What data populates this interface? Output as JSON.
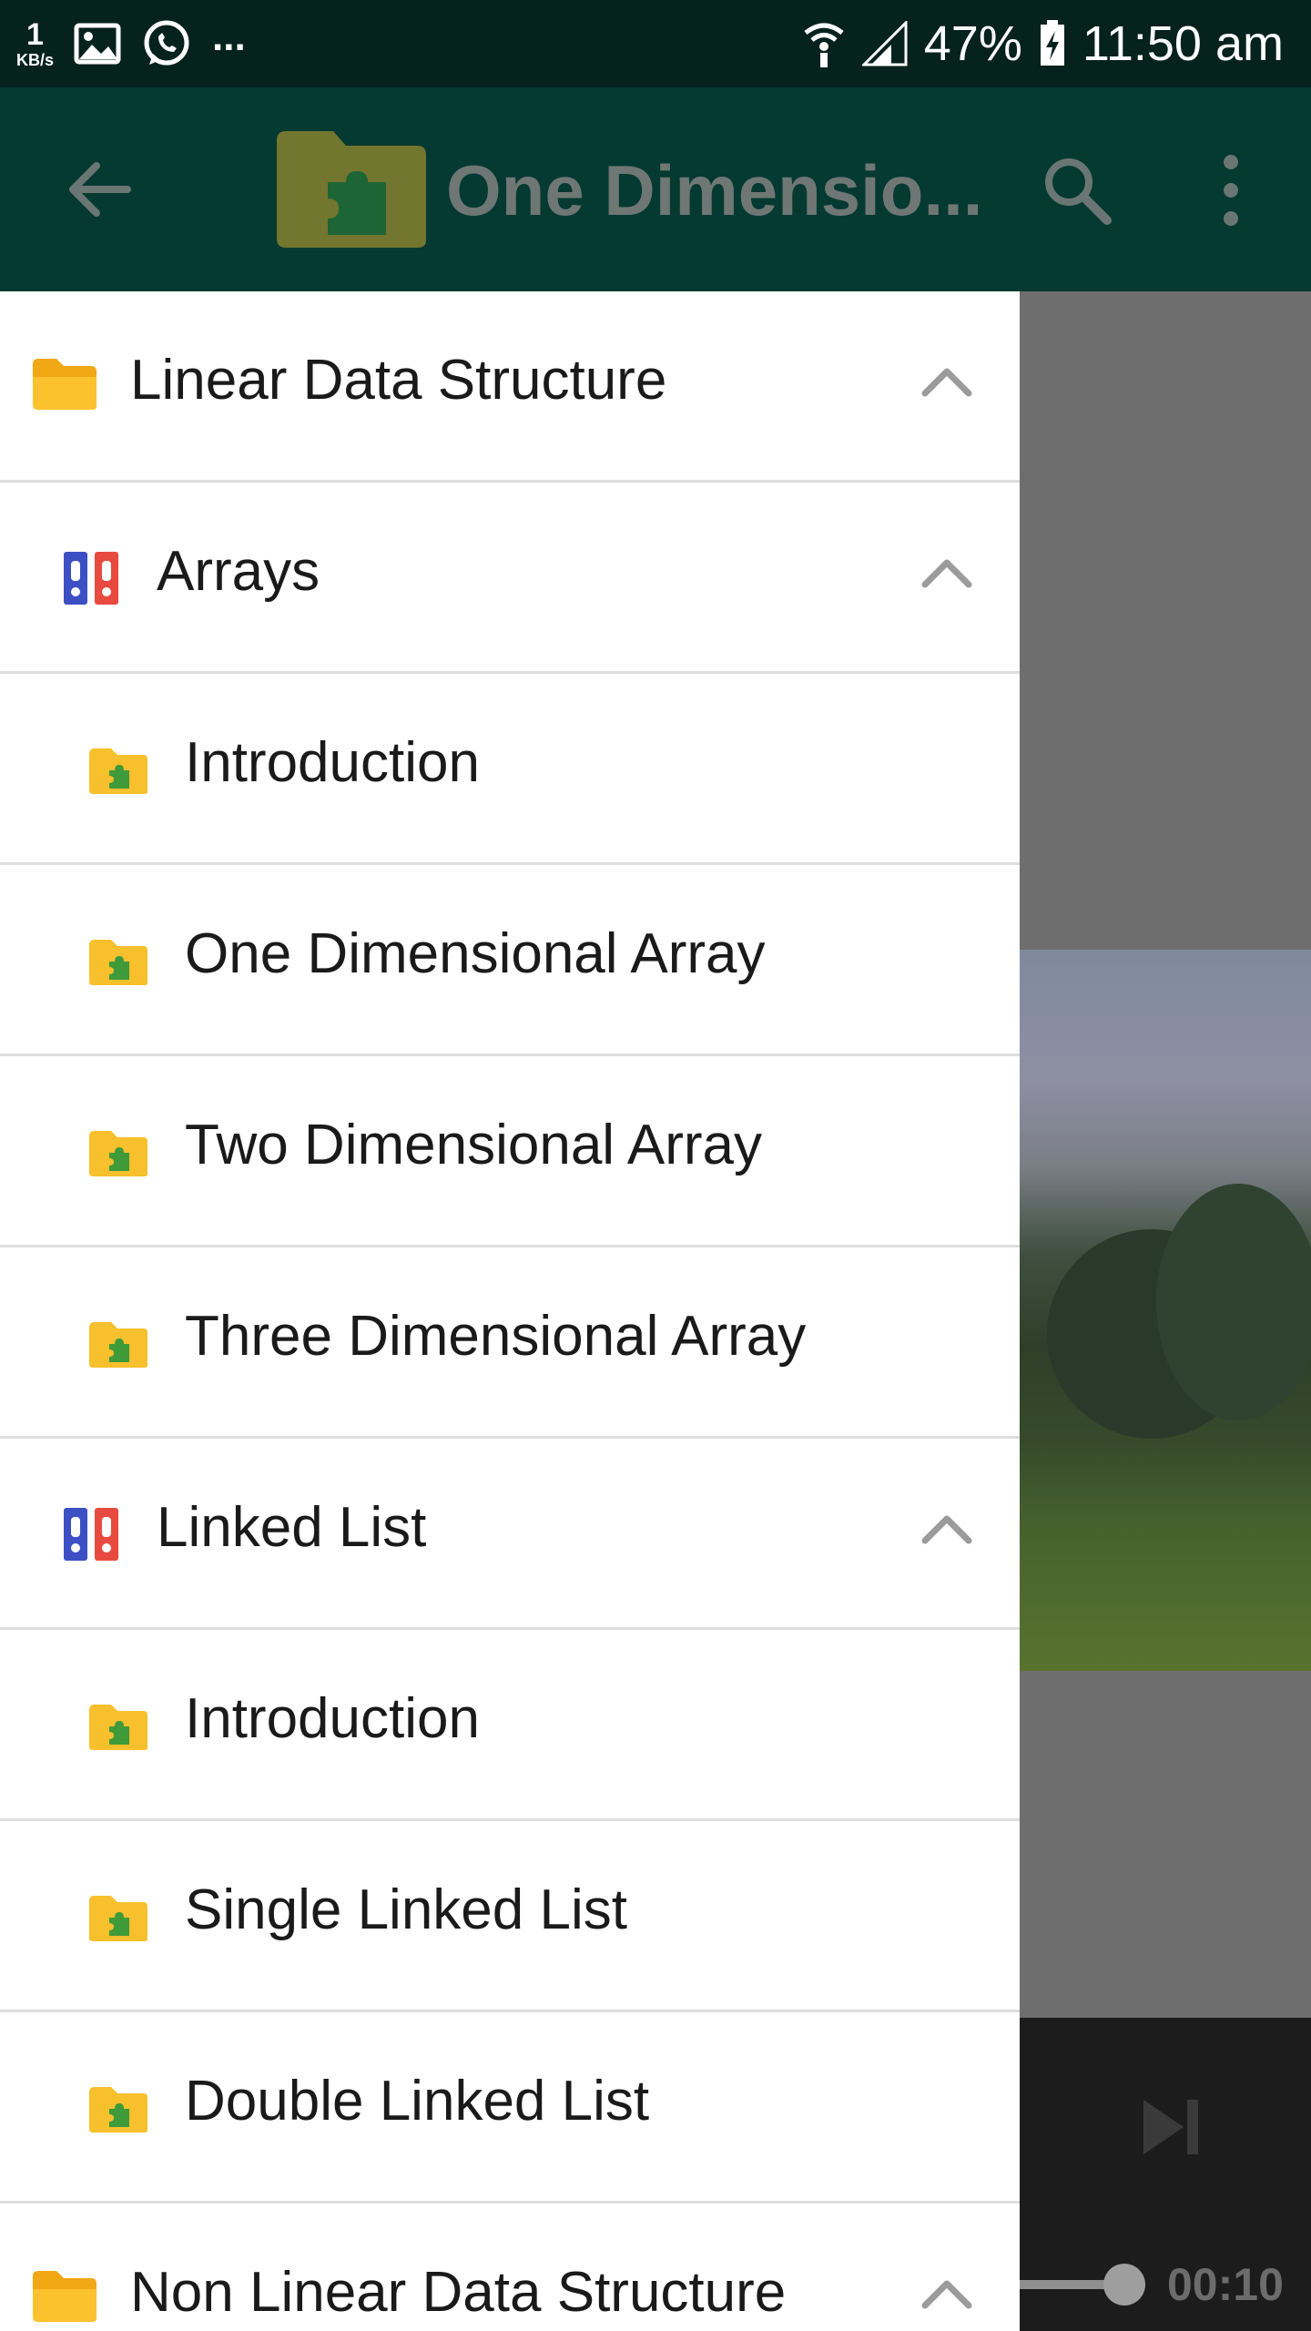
{
  "status_bar": {
    "speed_value": "1",
    "speed_unit": "KB/s",
    "more_notifications": "...",
    "battery": "47%",
    "time": "11:50 am"
  },
  "toolbar": {
    "title": "One Dimensio..."
  },
  "drawer": {
    "items": [
      {
        "level": 0,
        "label": "Linear Data Structure",
        "icon": "folder-icon",
        "expanded": true
      },
      {
        "level": 1,
        "label": "Arrays",
        "icon": "binders-icon",
        "expanded": true
      },
      {
        "level": 2,
        "label": "Introduction",
        "icon": "puzzle-folder-icon"
      },
      {
        "level": 2,
        "label": "One Dimensional Array",
        "icon": "puzzle-folder-icon"
      },
      {
        "level": 2,
        "label": "Two Dimensional Array",
        "icon": "puzzle-folder-icon"
      },
      {
        "level": 2,
        "label": "Three Dimensional Array",
        "icon": "puzzle-folder-icon"
      },
      {
        "level": 1,
        "label": "Linked List",
        "icon": "binders-icon",
        "expanded": true
      },
      {
        "level": 2,
        "label": "Introduction",
        "icon": "puzzle-folder-icon"
      },
      {
        "level": 2,
        "label": "Single Linked List",
        "icon": "puzzle-folder-icon"
      },
      {
        "level": 2,
        "label": "Double Linked List",
        "icon": "puzzle-folder-icon"
      },
      {
        "level": 0,
        "label": "Non Linear Data Structure",
        "icon": "folder-icon",
        "expanded": true
      }
    ]
  },
  "player": {
    "elapsed": "00:10"
  },
  "colors": {
    "status_bar_bg": "#05221d",
    "toolbar_bg": "#043a31",
    "folder_yellow": "#f7c02c",
    "puzzle_green": "#3f9a3a",
    "binder_blue": "#3d4fc4",
    "binder_red": "#e84a3f"
  }
}
